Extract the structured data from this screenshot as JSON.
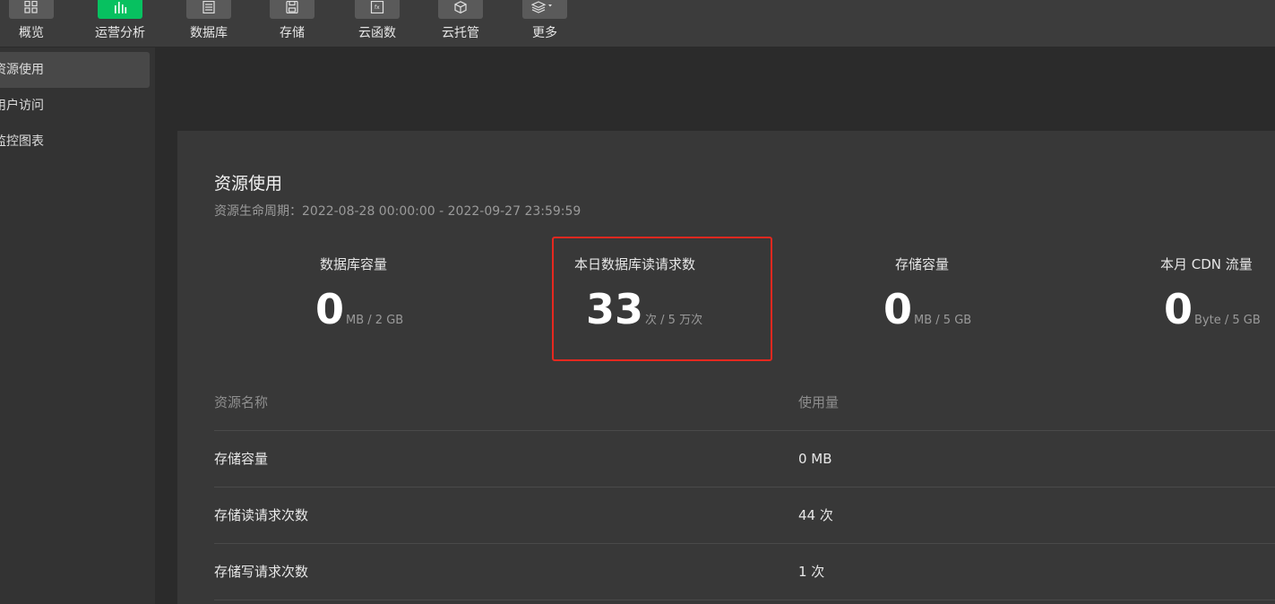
{
  "toolbar": {
    "items": [
      {
        "label": "概览",
        "icon": "grid-icon",
        "active": false
      },
      {
        "label": "运营分析",
        "icon": "bar-chart-icon",
        "active": true
      },
      {
        "label": "数据库",
        "icon": "database-icon",
        "active": false
      },
      {
        "label": "存储",
        "icon": "save-disk-icon",
        "active": false
      },
      {
        "label": "云函数",
        "icon": "function-icon",
        "active": false
      },
      {
        "label": "云托管",
        "icon": "cube-icon",
        "active": false
      },
      {
        "label": "更多",
        "icon": "layers-icon",
        "active": false
      }
    ]
  },
  "sidebar": {
    "items": [
      {
        "label": "资源使用",
        "active": true
      },
      {
        "label": "用户访问",
        "active": false
      },
      {
        "label": "监控图表",
        "active": false
      }
    ]
  },
  "panel": {
    "title": "资源使用",
    "subtitle": "资源生命周期：2022-08-28 00:00:00 - 2022-09-27 23:59:59",
    "stats": [
      {
        "label": "数据库容量",
        "value": "0",
        "unit": "MB / 2 GB"
      },
      {
        "label": "本日数据库读请求数",
        "value": "33",
        "unit": "次 / 5 万次"
      },
      {
        "label": "存储容量",
        "value": "0",
        "unit": "MB / 5 GB"
      },
      {
        "label": "本月 CDN 流量",
        "value": "0",
        "unit": "Byte / 5 GB"
      }
    ],
    "highlight_color": "#e5281f"
  },
  "table": {
    "headers": [
      "资源名称",
      "使用量"
    ],
    "rows": [
      [
        "存储容量",
        "0 MB"
      ],
      [
        "存储读请求次数",
        "44 次"
      ],
      [
        "存储写请求次数",
        "1 次"
      ]
    ]
  },
  "colors": {
    "accent": "#07c160",
    "background": "#2b2b2b",
    "panel": "#383838"
  }
}
